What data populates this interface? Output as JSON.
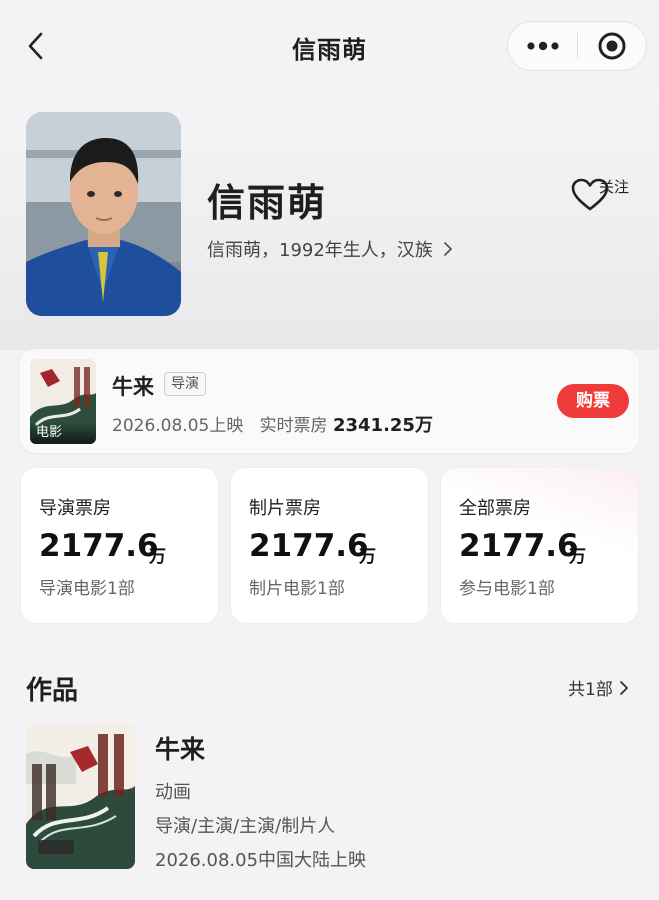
{
  "nav": {
    "title": "信雨萌",
    "back_icon": "chevron-left-icon",
    "more_icon": "more-dots-icon",
    "target_icon": "target-icon"
  },
  "person": {
    "name": "信雨萌",
    "description": "信雨萌，1992年生人，汉族",
    "follow_label": "关注"
  },
  "current_movie": {
    "title": "牛来",
    "role_tag": "导演",
    "poster_tag": "电影",
    "release": "2026.08.05上映",
    "box_label": "实时票房",
    "box_value": "2341.25万",
    "buy_label": "购票"
  },
  "stats": [
    {
      "title": "导演票房",
      "value": "2177.6",
      "unit": "万",
      "sub": "导演电影1部"
    },
    {
      "title": "制片票房",
      "value": "2177.6",
      "unit": "万",
      "sub": "制片电影1部"
    },
    {
      "title": "全部票房",
      "value": "2177.6",
      "unit": "万",
      "sub": "参与电影1部"
    }
  ],
  "works": {
    "section_title": "作品",
    "count_label": "共1部",
    "items": [
      {
        "title": "牛来",
        "type": "动画",
        "roles": "导演/主演/主演/制片人",
        "date": "2026.08.05中国大陆上映"
      }
    ]
  },
  "colors": {
    "accent_red": "#ef3c3a",
    "background": "#f3f3f5"
  }
}
